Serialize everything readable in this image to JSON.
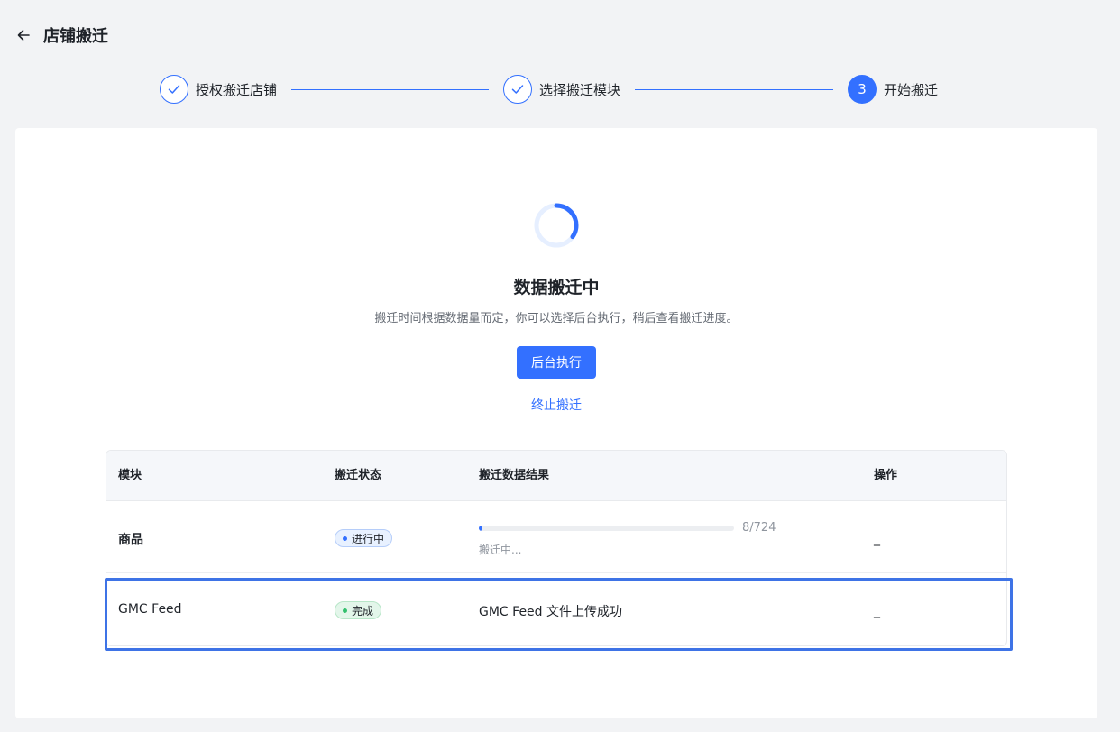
{
  "header": {
    "title": "店铺搬迁",
    "back_icon": "arrow-left-icon"
  },
  "steps": [
    {
      "label": "授权搬迁店铺",
      "status": "done",
      "icon": "check-icon"
    },
    {
      "label": "选择搬迁模块",
      "status": "done",
      "icon": "check-icon"
    },
    {
      "label": "开始搬迁",
      "status": "active",
      "number": "3"
    }
  ],
  "main": {
    "title": "数据搬迁中",
    "description": "搬迁时间根据数据量而定，你可以选择后台执行，稍后查看搬迁进度。",
    "background_button": "后台执行",
    "stop_link": "终止搬迁"
  },
  "table": {
    "columns": [
      "模块",
      "搬迁状态",
      "搬迁数据结果",
      "操作"
    ],
    "rows": [
      {
        "module": "商品",
        "status": "进行中",
        "progress": {
          "done": 8,
          "total": 724,
          "text": "8/724",
          "sub": "搬迁中..."
        },
        "action": "_"
      },
      {
        "module": "GMC Feed",
        "status": "完成",
        "result": "GMC Feed 文件上传成功",
        "action": "_"
      }
    ]
  },
  "colors": {
    "accent": "#3370ff",
    "success": "#34c06e",
    "highlight": "#3e73e6"
  }
}
